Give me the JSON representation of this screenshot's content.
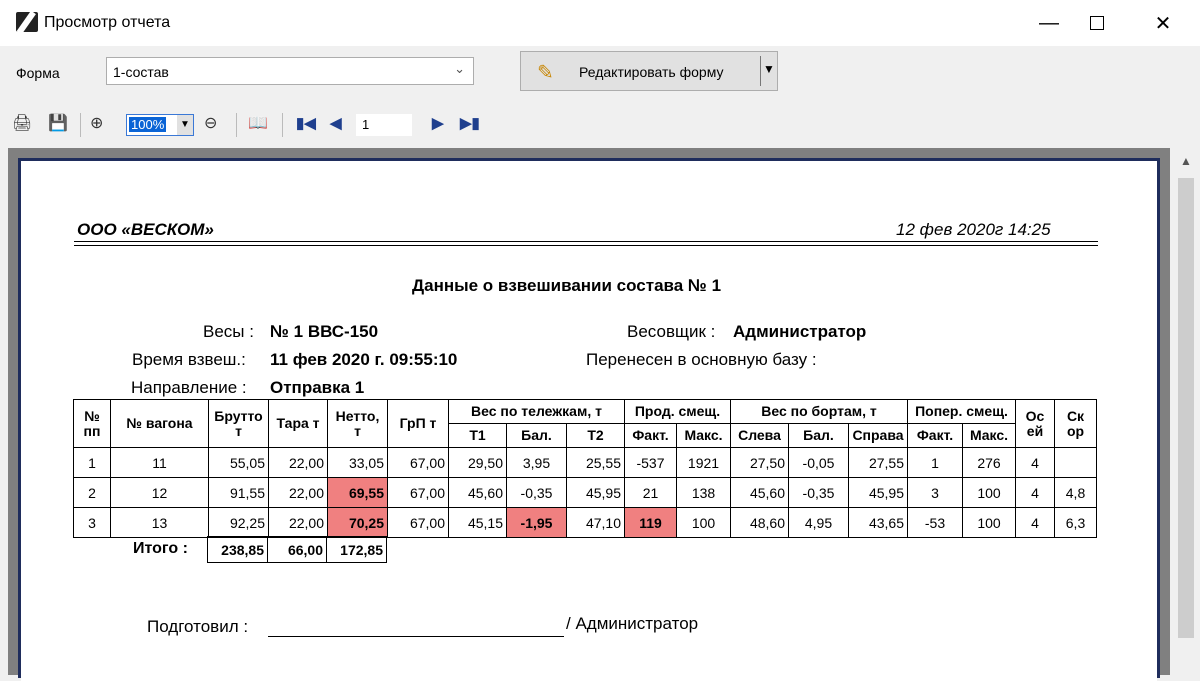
{
  "window": {
    "title": "Просмотр отчета",
    "minimize_icon": "minimize-icon",
    "maximize_icon": "maximize-icon",
    "close_icon": "close-icon"
  },
  "toolbar": {
    "form_label": "Форма",
    "form_value": "1-состав",
    "edit_button_label": "Редактировать форму",
    "zoom_value": "100%",
    "page_value": "1"
  },
  "report": {
    "company": "ООО «ВЕСКОМ»",
    "date": "12 фев 2020г  14:25",
    "title": "Данные о взвешивании состава № 1",
    "scales_label": "Весы :",
    "scales_value": "№ 1 ВВС-150",
    "time_label": "Время взвеш.:",
    "time_value": "11 фев 2020 г. 09:55:10",
    "direction_label": "Направление :",
    "direction_value": "Отправка 1",
    "weigher_label": "Весовщик :",
    "weigher_value": "Администратор",
    "transferred_label": "Перенесен в основную базу :",
    "headers": {
      "pp": "№ пп",
      "wagon": "№ вагона",
      "brutto": "Брутто т",
      "tara": "Тара т",
      "netto": "Нетто, т",
      "grp": "ГрП т",
      "bogie_group": "Вес по тележкам, т",
      "t1": "Т1",
      "bal1": "Бал.",
      "t2": "Т2",
      "long_group": "Прод. смещ.",
      "fact1": "Факт.",
      "max1": "Макс.",
      "side_group": "Вес по бортам, т",
      "left": "Слева",
      "bal2": "Бал.",
      "right": "Справа",
      "cross_group": "Попер. смещ.",
      "fact2": "Факт.",
      "max2": "Макс.",
      "axles": "Ос ей",
      "speed": "Ск ор"
    },
    "rows": [
      [
        "1",
        "11",
        "55,05",
        "22,00",
        "33,05",
        "67,00",
        "29,50",
        "3,95",
        "25,55",
        "-537",
        "1921",
        "27,50",
        "-0,05",
        "27,55",
        "1",
        "276",
        "4",
        ""
      ],
      [
        "2",
        "12",
        "91,55",
        "22,00",
        "69,55",
        "67,00",
        "45,60",
        "-0,35",
        "45,95",
        "21",
        "138",
        "45,60",
        "-0,35",
        "45,95",
        "3",
        "100",
        "4",
        "4,8"
      ],
      [
        "3",
        "13",
        "92,25",
        "22,00",
        "70,25",
        "67,00",
        "45,15",
        "-1,95",
        "47,10",
        "119",
        "100",
        "48,60",
        "4,95",
        "43,65",
        "-53",
        "100",
        "4",
        "6,3"
      ]
    ],
    "totals_label": "Итого :",
    "totals": [
      "238,85",
      "66,00",
      "172,85"
    ],
    "prepared_label": "Подготовил :",
    "prepared_name": "/ Администратор"
  }
}
